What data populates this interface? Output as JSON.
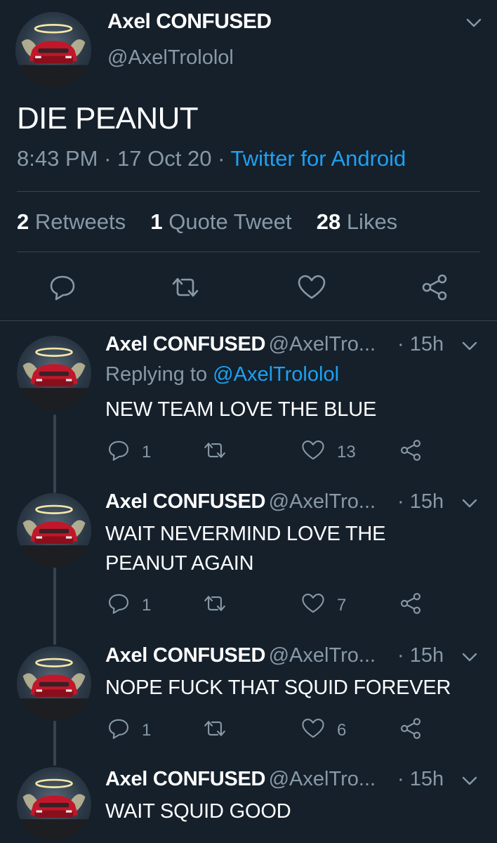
{
  "main_tweet": {
    "author_name": "Axel CONFUSED",
    "author_handle": "@AxelTrololol",
    "text": "DIE PEANUT",
    "time": "8:43 PM",
    "sep1": "·",
    "date": "17 Oct 20",
    "sep2": "·",
    "source": "Twitter for Android",
    "stats": {
      "retweets_count": "2",
      "retweets_label": "Retweets",
      "quotes_count": "1",
      "quotes_label": "Quote Tweet",
      "likes_count": "28",
      "likes_label": "Likes"
    }
  },
  "replies": [
    {
      "author_name": "Axel CONFUSED",
      "author_handle": "@AxelTro...",
      "time": "· 15h",
      "replying_prefix": "Replying to",
      "replying_to": "@AxelTrololol",
      "text": "NEW TEAM LOVE THE BLUE",
      "reply_count": "1",
      "like_count": "13"
    },
    {
      "author_name": "Axel CONFUSED",
      "author_handle": "@AxelTro...",
      "time": "· 15h",
      "text_line1": "WAIT NEVERMIND LOVE THE",
      "text_line2": "PEANUT AGAIN",
      "reply_count": "1",
      "like_count": "7"
    },
    {
      "author_name": "Axel CONFUSED",
      "author_handle": "@AxelTro...",
      "time": "· 15h",
      "text": "NOPE FUCK THAT SQUID FOREVER",
      "reply_count": "1",
      "like_count": "6"
    },
    {
      "author_name": "Axel CONFUSED",
      "author_handle": "@AxelTro...",
      "time": "· 15h",
      "text": "WAIT SQUID GOOD"
    }
  ],
  "icons": {
    "reply": "reply-icon",
    "retweet": "retweet-icon",
    "like": "heart-icon",
    "share": "share-icon",
    "menu": "chevron-down-icon"
  },
  "colors": {
    "background": "#15202b",
    "divider": "#38444d",
    "muted": "#8899a6",
    "accent": "#1da1f2"
  }
}
